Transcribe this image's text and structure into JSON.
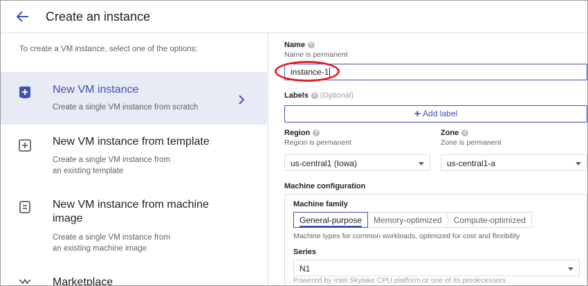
{
  "header": {
    "title": "Create an instance"
  },
  "left": {
    "intro": "To create a VM instance, select one of the options:",
    "options": [
      {
        "title": "New VM instance",
        "desc": "Create a single VM instance from scratch"
      },
      {
        "title": "New VM instance from template",
        "desc1": "Create a single VM instance from",
        "desc2": "an existing template"
      },
      {
        "title1": "New VM instance from machine",
        "title2": "image",
        "desc1": "Create a single VM instance from",
        "desc2": "an existing machine image"
      },
      {
        "title": "Marketplace"
      }
    ]
  },
  "form": {
    "name": {
      "label": "Name",
      "hint": "Name is permanent",
      "value": "instance-1"
    },
    "labels": {
      "label": "Labels",
      "optional": "(Optional)",
      "add_label": "Add label"
    },
    "region": {
      "label": "Region",
      "hint": "Region is permanent",
      "value": "us-central1 (Iowa)"
    },
    "zone": {
      "label": "Zone",
      "hint": "Zone is permanent",
      "value": "us-central1-a"
    },
    "machine": {
      "section_title": "Machine configuration",
      "family_label": "Machine family",
      "tabs": [
        "General-purpose",
        "Memory-optimized",
        "Compute-optimized"
      ],
      "family_note": "Machine types for common workloads, optimized for cost and flexibility",
      "series_label": "Series",
      "series_value": "N1",
      "series_note": "Powered by Intel Skylake CPU platform or one of its predecessors"
    }
  },
  "colors": {
    "accent": "#3f51b5",
    "selected_bg": "#e8eaf6",
    "highlight_ring": "#e0202a"
  }
}
